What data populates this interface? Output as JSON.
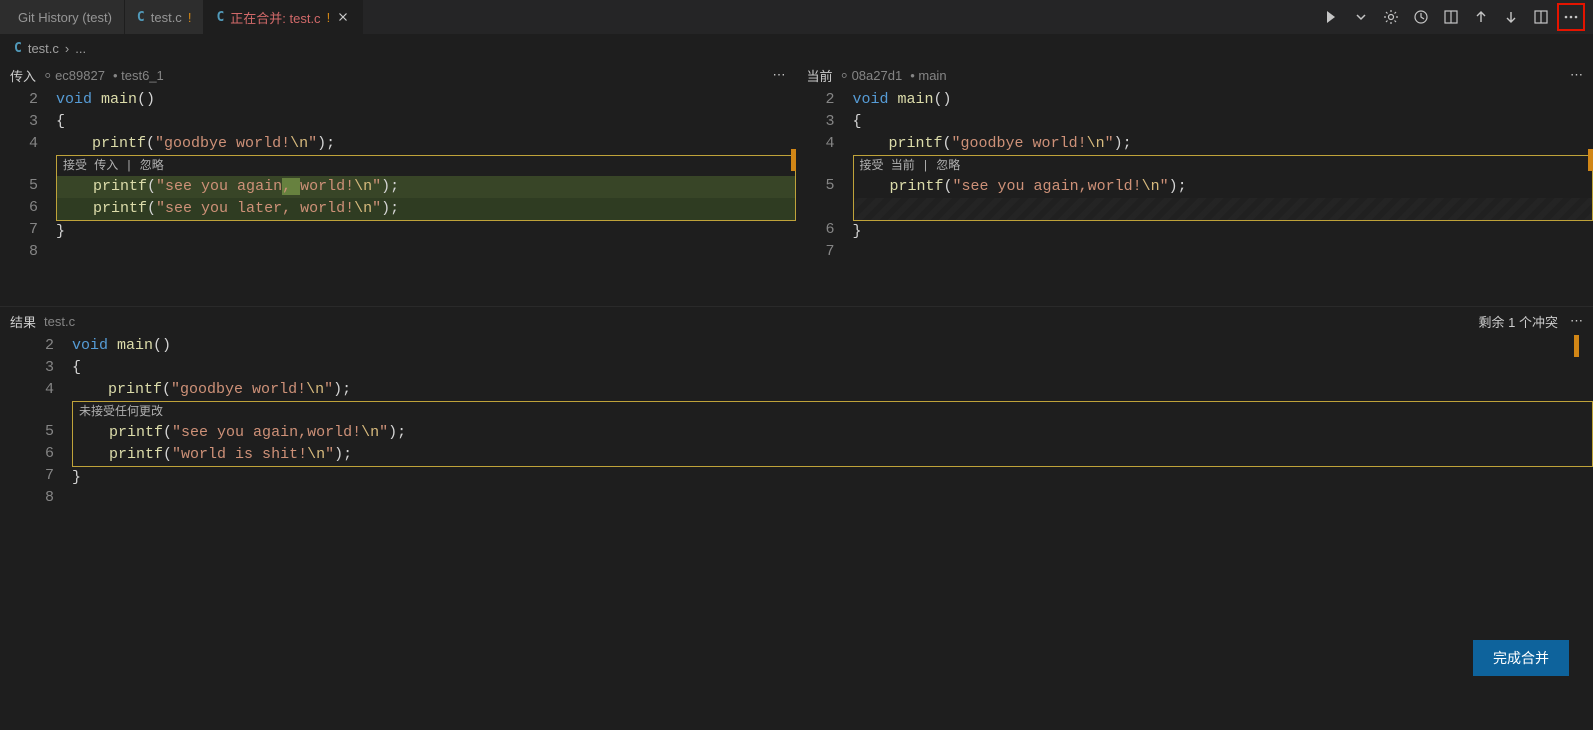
{
  "tabs": [
    {
      "icon": "history",
      "title": "Git History (test)"
    },
    {
      "icon": "C",
      "title": "test.c",
      "modified": "!"
    },
    {
      "icon": "C",
      "title": "正在合并: test.c",
      "modified": "!",
      "active": true,
      "color": "#d16969"
    }
  ],
  "toolbar_icons": [
    "run",
    "gear",
    "history",
    "diff",
    "up",
    "down",
    "split",
    "more"
  ],
  "breadcrumb": {
    "icon": "C",
    "file": "test.c",
    "sep": "›",
    "dots": "..."
  },
  "incoming": {
    "label": "传入",
    "commit": "ec89827",
    "branch": "test6_1",
    "actions": "接受 传入 | 忽略",
    "lines": [
      {
        "n": 2,
        "tokens": [
          [
            "kw-void",
            "void "
          ],
          [
            "fn",
            "main"
          ],
          [
            "paren",
            "()"
          ]
        ]
      },
      {
        "n": 3,
        "tokens": [
          [
            "brace",
            "{"
          ]
        ]
      },
      {
        "n": 4,
        "tokens": [
          [
            "plain",
            "    "
          ],
          [
            "fn",
            "printf"
          ],
          [
            "paren",
            "("
          ],
          [
            "str",
            "\"goodbye world!"
          ],
          [
            "esc",
            "\\n"
          ],
          [
            "str",
            "\""
          ],
          [
            "paren",
            ")"
          ],
          [
            "punct",
            ";"
          ]
        ]
      }
    ],
    "conflict_lines": [
      {
        "n": 5,
        "tokens": [
          [
            "plain",
            "    "
          ],
          [
            "fn",
            "printf"
          ],
          [
            "paren",
            "("
          ],
          [
            "str",
            "\"see you again"
          ],
          [
            "word-diff str",
            ", "
          ],
          [
            "str",
            "world!"
          ],
          [
            "esc",
            "\\n"
          ],
          [
            "str",
            "\""
          ],
          [
            "paren",
            ")"
          ],
          [
            "punct",
            ";"
          ]
        ]
      },
      {
        "n": 6,
        "tokens": [
          [
            "plain",
            "    "
          ],
          [
            "fn",
            "printf"
          ],
          [
            "paren",
            "("
          ],
          [
            "str",
            "\"see you later, world!"
          ],
          [
            "esc",
            "\\n"
          ],
          [
            "str",
            "\""
          ],
          [
            "paren",
            ")"
          ],
          [
            "punct",
            ";"
          ]
        ]
      }
    ],
    "after_lines": [
      {
        "n": 7,
        "tokens": [
          [
            "brace",
            "}"
          ]
        ]
      },
      {
        "n": 8,
        "tokens": [
          [
            "plain",
            ""
          ]
        ]
      }
    ]
  },
  "current": {
    "label": "当前",
    "commit": "08a27d1",
    "branch": "main",
    "actions": "接受 当前 | 忽略",
    "lines": [
      {
        "n": 2,
        "tokens": [
          [
            "kw-void",
            "void "
          ],
          [
            "fn",
            "main"
          ],
          [
            "paren",
            "()"
          ]
        ]
      },
      {
        "n": 3,
        "tokens": [
          [
            "brace",
            "{"
          ]
        ]
      },
      {
        "n": 4,
        "tokens": [
          [
            "plain",
            "    "
          ],
          [
            "fn",
            "printf"
          ],
          [
            "paren",
            "("
          ],
          [
            "str",
            "\"goodbye world!"
          ],
          [
            "esc",
            "\\n"
          ],
          [
            "str",
            "\""
          ],
          [
            "paren",
            ")"
          ],
          [
            "punct",
            ";"
          ]
        ]
      }
    ],
    "conflict_lines": [
      {
        "n": 5,
        "tokens": [
          [
            "plain",
            "    "
          ],
          [
            "fn",
            "printf"
          ],
          [
            "paren",
            "("
          ],
          [
            "str",
            "\"see you again,world!"
          ],
          [
            "esc",
            "\\n"
          ],
          [
            "str",
            "\""
          ],
          [
            "paren",
            ")"
          ],
          [
            "punct",
            ";"
          ]
        ]
      }
    ],
    "after_lines": [
      {
        "n": 6,
        "tokens": [
          [
            "brace",
            "}"
          ]
        ]
      },
      {
        "n": 7,
        "tokens": [
          [
            "plain",
            ""
          ]
        ]
      }
    ]
  },
  "result": {
    "label": "结果",
    "file": "test.c",
    "remaining": "剩余 1 个冲突",
    "banner": "未接受任何更改",
    "lines": [
      {
        "n": 2,
        "tokens": [
          [
            "kw-void",
            "void "
          ],
          [
            "fn",
            "main"
          ],
          [
            "paren",
            "()"
          ]
        ]
      },
      {
        "n": 3,
        "tokens": [
          [
            "brace",
            "{"
          ]
        ]
      },
      {
        "n": 4,
        "tokens": [
          [
            "plain",
            "    "
          ],
          [
            "fn",
            "printf"
          ],
          [
            "paren",
            "("
          ],
          [
            "str",
            "\"goodbye world!"
          ],
          [
            "esc",
            "\\n"
          ],
          [
            "str",
            "\""
          ],
          [
            "paren",
            ")"
          ],
          [
            "punct",
            ";"
          ]
        ]
      }
    ],
    "conflict_lines": [
      {
        "n": 5,
        "tokens": [
          [
            "plain",
            "    "
          ],
          [
            "fn",
            "printf"
          ],
          [
            "paren",
            "("
          ],
          [
            "str",
            "\"see you again,world!"
          ],
          [
            "esc",
            "\\n"
          ],
          [
            "str",
            "\""
          ],
          [
            "paren",
            ")"
          ],
          [
            "punct",
            ";"
          ]
        ]
      },
      {
        "n": 6,
        "tokens": [
          [
            "plain",
            "    "
          ],
          [
            "fn",
            "printf"
          ],
          [
            "paren",
            "("
          ],
          [
            "str",
            "\"world is shit!"
          ],
          [
            "esc",
            "\\n"
          ],
          [
            "str",
            "\""
          ],
          [
            "paren",
            ")"
          ],
          [
            "punct",
            ";"
          ]
        ]
      }
    ],
    "after_lines": [
      {
        "n": 7,
        "tokens": [
          [
            "brace",
            "}"
          ]
        ]
      },
      {
        "n": 8,
        "tokens": [
          [
            "plain",
            ""
          ]
        ]
      }
    ]
  },
  "complete_button": "完成合并"
}
